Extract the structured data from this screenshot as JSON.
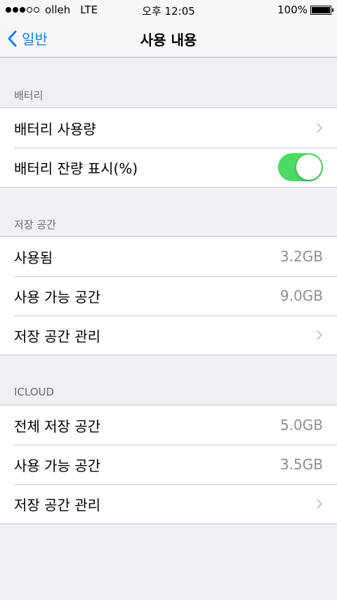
{
  "status_bar": {
    "carrier": "olleh",
    "network": "LTE",
    "time": "오후 12:05",
    "battery_percent": "100%",
    "signal_bars": 3,
    "signal_total": 5
  },
  "nav": {
    "back_label": "일반",
    "title": "사용 내용"
  },
  "sections": {
    "battery": {
      "header": "배터리",
      "usage_label": "배터리 사용량",
      "percentage_label": "배터리 잔량 표시(%)",
      "percentage_on": true
    },
    "storage": {
      "header": "저장 공간",
      "used_label": "사용됨",
      "used_value": "3.2GB",
      "available_label": "사용 가능 공간",
      "available_value": "9.0GB",
      "manage_label": "저장 공간 관리"
    },
    "icloud": {
      "header": "ICLOUD",
      "total_label": "전체 저장 공간",
      "total_value": "5.0GB",
      "available_label": "사용 가능 공간",
      "available_value": "3.5GB",
      "manage_label": "저장 공간 관리"
    }
  },
  "colors": {
    "accent": "#147efb",
    "toggle_on": "#4cd964",
    "background": "#efeff4",
    "secondary_text": "#8e8e93"
  },
  "icons": {
    "back": "chevron-left-icon",
    "disclosure": "chevron-right-icon"
  }
}
